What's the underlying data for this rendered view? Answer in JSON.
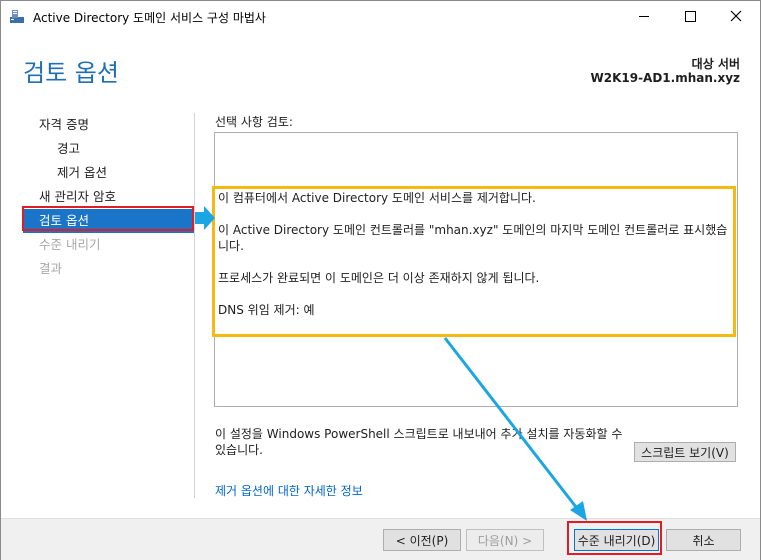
{
  "window": {
    "title": "Active Directory 도메인 서비스 구성 마법사",
    "icons": {
      "app": "server-manager-icon",
      "minimize": "minimize-icon",
      "maximize": "maximize-icon",
      "close": "close-icon"
    }
  },
  "header": {
    "page_title": "검토 옵션",
    "target_label": "대상 서버",
    "target_value": "W2K19-AD1.mhan.xyz"
  },
  "nav": {
    "items": [
      {
        "label": "자격 증명",
        "level": 0,
        "state": "normal"
      },
      {
        "label": "경고",
        "level": 1,
        "state": "normal"
      },
      {
        "label": "제거 옵션",
        "level": 1,
        "state": "normal"
      },
      {
        "label": "새 관리자 암호",
        "level": 0,
        "state": "normal"
      },
      {
        "label": "검토 옵션",
        "level": 0,
        "state": "selected"
      },
      {
        "label": "수준 내리기",
        "level": 0,
        "state": "disabled"
      },
      {
        "label": "결과",
        "level": 0,
        "state": "disabled"
      }
    ]
  },
  "main": {
    "review_label": "선택 사항 검토:",
    "review_lines": [
      "이 컴퓨터에서 Active Directory 도메인 서비스를 제거합니다.",
      "이 Active Directory 도메인 컨트롤러를 \"mhan.xyz\" 도메인의 마지막 도메인 컨트롤러로 표시했습니다.",
      "프로세스가 완료되면 이 도메인은 더 이상 존재하지 않게 됩니다.",
      "DNS 위임 제거: 예"
    ],
    "powershell_text": "이 설정을 Windows PowerShell 스크립트로 내보내어 추가 설치를 자동화할 수 있습니다.",
    "script_button": "스크립트 보기(V)",
    "more_link": "제거 옵션에 대한 자세한 정보"
  },
  "footer": {
    "prev": "< 이전(P)",
    "next": "다음(N) >",
    "demote": "수준 내리기(D)",
    "cancel": "취소"
  },
  "colors": {
    "accent": "#1a74c8",
    "highlight_red": "#e31b23",
    "highlight_yellow": "#f5b913",
    "arrow_blue": "#1ba6e3"
  }
}
